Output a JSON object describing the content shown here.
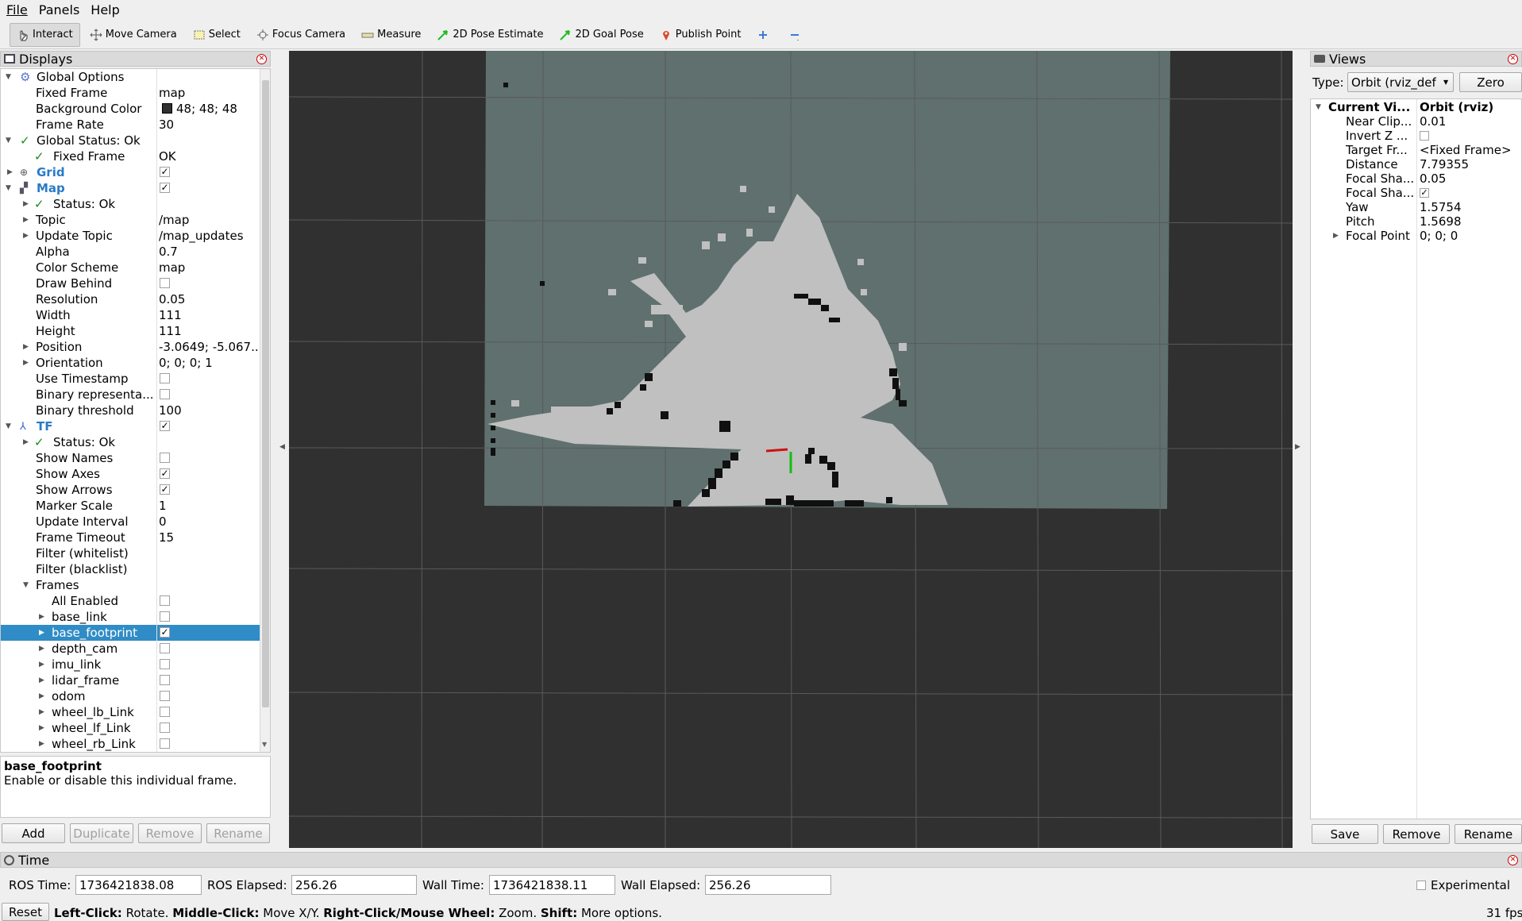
{
  "menu": {
    "file": "File",
    "panels": "Panels",
    "help": "Help"
  },
  "toolbar": {
    "interact": "Interact",
    "move_camera": "Move Camera",
    "select": "Select",
    "focus_camera": "Focus Camera",
    "measure": "Measure",
    "pose_estimate": "2D Pose Estimate",
    "goal_pose": "2D Goal Pose",
    "publish_point": "Publish Point"
  },
  "displays": {
    "title": "Displays",
    "global_options": "Global Options",
    "fixed_frame_label": "Fixed Frame",
    "fixed_frame_value": "map",
    "bg_color_label": "Background Color",
    "bg_color_value": "48; 48; 48",
    "frame_rate_label": "Frame Rate",
    "frame_rate_value": "30",
    "global_status": "Global Status: Ok",
    "gs_fixed_frame": "Fixed Frame",
    "gs_fixed_frame_value": "OK",
    "grid": "Grid",
    "map": "Map",
    "map_status": "Status: Ok",
    "topic_label": "Topic",
    "topic_value": "/map",
    "update_topic_label": "Update Topic",
    "update_topic_value": "/map_updates",
    "alpha_label": "Alpha",
    "alpha_value": "0.7",
    "color_scheme_label": "Color Scheme",
    "color_scheme_value": "map",
    "draw_behind": "Draw Behind",
    "resolution_label": "Resolution",
    "resolution_value": "0.05",
    "width_label": "Width",
    "width_value": "111",
    "height_label": "Height",
    "height_value": "111",
    "position_label": "Position",
    "position_value": "-3.0649; -5.067...",
    "orientation_label": "Orientation",
    "orientation_value": "0; 0; 0; 1",
    "use_timestamp": "Use Timestamp",
    "binary_rep": "Binary representa...",
    "binary_threshold_label": "Binary threshold",
    "binary_threshold_value": "100",
    "tf": "TF",
    "tf_status": "Status: Ok",
    "show_names": "Show Names",
    "show_axes": "Show Axes",
    "show_arrows": "Show Arrows",
    "marker_scale_label": "Marker Scale",
    "marker_scale_value": "1",
    "update_interval_label": "Update Interval",
    "update_interval_value": "0",
    "frame_timeout_label": "Frame Timeout",
    "frame_timeout_value": "15",
    "filter_white": "Filter (whitelist)",
    "filter_black": "Filter (blacklist)",
    "frames": "Frames",
    "all_enabled": "All Enabled",
    "frame_items": [
      "base_link",
      "base_footprint",
      "depth_cam",
      "imu_link",
      "lidar_frame",
      "odom",
      "wheel_lb_Link",
      "wheel_lf_Link",
      "wheel_rb_Link"
    ],
    "desc_title": "base_footprint",
    "desc_text": "Enable or disable this individual frame.",
    "add": "Add",
    "duplicate": "Duplicate",
    "remove": "Remove",
    "rename": "Rename"
  },
  "views": {
    "title": "Views",
    "type_label": "Type:",
    "type_value": "Orbit (rviz_def",
    "zero": "Zero",
    "current_view": "Current Vi...",
    "current_view_value": "Orbit (rviz)",
    "near_clip": "Near Clip...",
    "near_clip_value": "0.01",
    "invert_z": "Invert Z ...",
    "target_frame": "Target Fr...",
    "target_frame_value": "<Fixed Frame>",
    "distance": "Distance",
    "distance_value": "7.79355",
    "focal_shape_size": "Focal Sha...",
    "focal_shape_size_value": "0.05",
    "focal_shape_fixed": "Focal Sha...",
    "yaw": "Yaw",
    "yaw_value": "1.5754",
    "pitch": "Pitch",
    "pitch_value": "1.5698",
    "focal_point": "Focal Point",
    "focal_point_value": "0; 0; 0",
    "save": "Save",
    "remove": "Remove",
    "rename": "Rename"
  },
  "time": {
    "title": "Time",
    "ros_time_label": "ROS Time:",
    "ros_time_value": "1736421838.08",
    "ros_elapsed_label": "ROS Elapsed:",
    "ros_elapsed_value": "256.26",
    "wall_time_label": "Wall Time:",
    "wall_time_value": "1736421838.11",
    "wall_elapsed_label": "Wall Elapsed:",
    "wall_elapsed_value": "256.26",
    "experimental": "Experimental"
  },
  "status": {
    "reset": "Reset",
    "left_click": "Left-Click:",
    "left_click_desc": " Rotate. ",
    "middle_click": "Middle-Click:",
    "middle_click_desc": " Move X/Y. ",
    "right_click": "Right-Click/Mouse Wheel:",
    "right_click_desc": " Zoom. ",
    "shift": "Shift:",
    "shift_desc": " More options.",
    "fps": "31 fps"
  },
  "colors": {
    "background": "#303030",
    "selection": "#308cc6",
    "map_unknown": "#5f706e",
    "map_free": "#c0c0c0",
    "map_occupied": "#101010"
  }
}
